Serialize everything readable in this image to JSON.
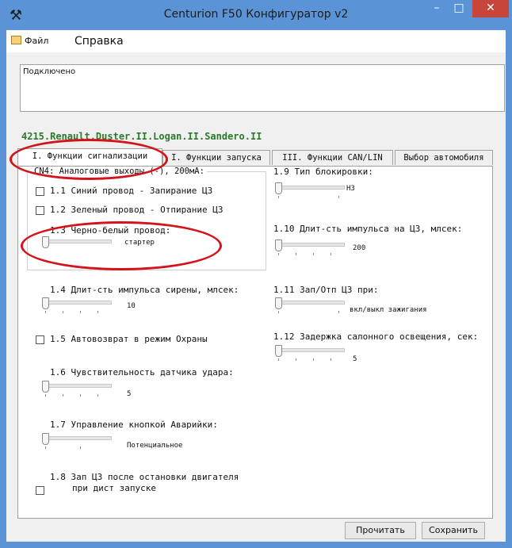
{
  "window": {
    "title": "Centurion F50 Конфигуратор v2",
    "minimize": "–",
    "maximize": "□",
    "close": "✕"
  },
  "menu": {
    "file": "Файл",
    "help": "Справка"
  },
  "status": {
    "text": "Подключено"
  },
  "car": {
    "title": "4215.Renault.Duster.II.Logan.II.Sandero.II"
  },
  "tabs": [
    {
      "label": "I. Функции сигнализации"
    },
    {
      "label": "I. Функции запуска"
    },
    {
      "label": "III. Функции CAN/LIN"
    },
    {
      "label": "Выбор автомобиля"
    }
  ],
  "group": {
    "label": "CN4: Аналоговые выходы (-), 200мА:"
  },
  "left": {
    "opt_1_1": "1.1 Синий провод - Запирание ЦЗ",
    "opt_1_2": "1.2 Зеленый провод - Отпирание ЦЗ",
    "opt_1_3": "1.3 Черно-белый провод:",
    "opt_1_3_value": "стартер",
    "opt_1_4": "1.4 Длит-сть импульса сирены, млсек:",
    "opt_1_4_value": "10",
    "opt_1_5": "1.5 Автовозврат в режим Охраны",
    "opt_1_6": "1.6 Чувствительность датчика удара:",
    "opt_1_6_value": "5",
    "opt_1_7": "1.7 Управление кнопкой Аварийки:",
    "opt_1_7_value": "Потенциальное",
    "opt_1_8_line1": "1.8 Зап ЦЗ после остановки двигателя",
    "opt_1_8_line2": "при дист запуске"
  },
  "right": {
    "opt_1_9": "1.9  Тип блокировки:",
    "opt_1_9_value": "НЗ",
    "opt_1_10": "1.10 Длит-сть импульса на ЦЗ, млсек:",
    "opt_1_10_value": "200",
    "opt_1_11": "1.11 Зап/Отп ЦЗ при:",
    "opt_1_11_value": "вкл/выкл зажигания",
    "opt_1_12": "1.12 Задержка салонного освещения, сек:",
    "opt_1_12_value": "5"
  },
  "buttons": {
    "read": "Прочитать",
    "save": "Сохранить"
  },
  "colors": {
    "titlebar": "#5a94d6",
    "close": "#c7453b",
    "car_title": "#2b7a2b",
    "annotation": "#d4141c"
  }
}
